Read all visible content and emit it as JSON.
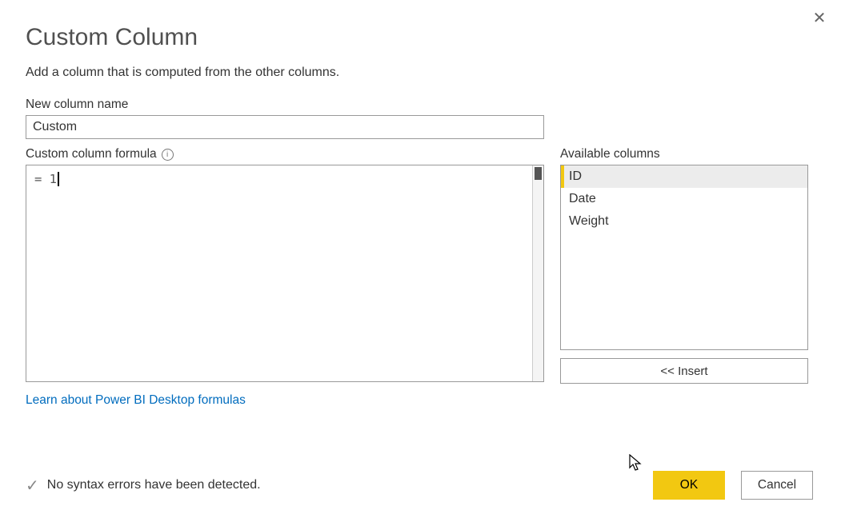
{
  "dialog": {
    "title": "Custom Column",
    "subtitle": "Add a column that is computed from the other columns.",
    "close_icon": "✕"
  },
  "name_section": {
    "label": "New column name",
    "value": "Custom"
  },
  "formula_section": {
    "label": "Custom column formula",
    "equals": "= ",
    "value": "1"
  },
  "available": {
    "label": "Available columns",
    "items": [
      "ID",
      "Date",
      "Weight"
    ],
    "selected_index": 0,
    "insert_label": "<< Insert"
  },
  "learn_link": "Learn about Power BI Desktop formulas",
  "status": {
    "check": "✓",
    "text": "No syntax errors have been detected."
  },
  "buttons": {
    "ok": "OK",
    "cancel": "Cancel"
  },
  "colors": {
    "accent": "#f2c811",
    "link": "#006cbe"
  }
}
